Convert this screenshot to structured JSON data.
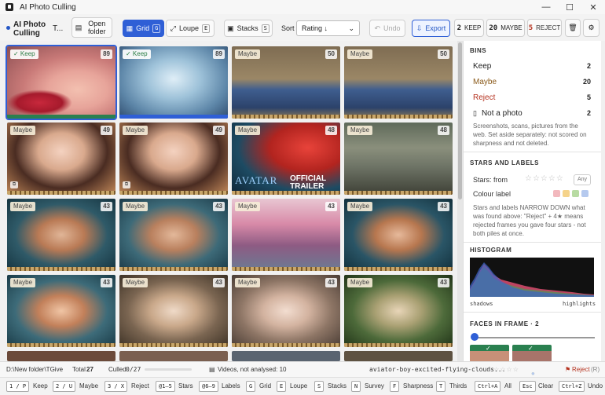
{
  "window": {
    "title": "AI Photo Culling"
  },
  "brand": {
    "name": "AI Photo Culling",
    "more": "T..."
  },
  "toolbar": {
    "open_folder": "Open folder",
    "grid": {
      "label": "Grid",
      "key": "G"
    },
    "loupe": {
      "label": "Loupe",
      "key": "E"
    },
    "stacks": {
      "label": "Stacks",
      "key": "S"
    },
    "sort_label": "Sort",
    "sort_value": "Rating ↓",
    "undo": "Undo",
    "export": "Export",
    "keep": {
      "count": "2",
      "label": "KEEP"
    },
    "maybe": {
      "count": "20",
      "label": "MAYBE"
    },
    "reject": {
      "count": "5",
      "label": "REJECT"
    }
  },
  "thumbs": [
    {
      "tag": "✓ Keep",
      "score": "89",
      "kind": "keep"
    },
    {
      "tag": "✓ Keep",
      "score": "89",
      "kind": "keep"
    },
    {
      "tag": "Maybe",
      "score": "50",
      "kind": "maybe"
    },
    {
      "tag": "Maybe",
      "score": "50",
      "kind": "maybe"
    },
    {
      "tag": "Maybe",
      "score": "49",
      "kind": "maybe"
    },
    {
      "tag": "Maybe",
      "score": "49",
      "kind": "maybe"
    },
    {
      "tag": "Maybe",
      "score": "48",
      "kind": "maybe",
      "trailer": "OFFICIAL TRAILER",
      "avatar": "AVATAR"
    },
    {
      "tag": "Maybe",
      "score": "48",
      "kind": "maybe"
    },
    {
      "tag": "Maybe",
      "score": "43",
      "kind": "maybe"
    },
    {
      "tag": "Maybe",
      "score": "43",
      "kind": "maybe"
    },
    {
      "tag": "Maybe",
      "score": "43",
      "kind": "maybe"
    },
    {
      "tag": "Maybe",
      "score": "43",
      "kind": "maybe"
    },
    {
      "tag": "Maybe",
      "score": "43",
      "kind": "maybe"
    },
    {
      "tag": "Maybe",
      "score": "43",
      "kind": "maybe"
    },
    {
      "tag": "Maybe",
      "score": "43",
      "kind": "maybe"
    },
    {
      "tag": "Maybe",
      "score": "43",
      "kind": "maybe"
    }
  ],
  "sidebar": {
    "bins_heading": "BINS",
    "bins": [
      {
        "label": "Keep",
        "count": "2",
        "color": "#222"
      },
      {
        "label": "Maybe",
        "count": "20",
        "color": "#8a5a1a"
      },
      {
        "label": "Reject",
        "count": "5",
        "color": "#b5321f"
      },
      {
        "label": "Not a photo",
        "count": "2",
        "color": "#222"
      }
    ],
    "bins_note": "Screenshots, scans, pictures from the web. Set aside separately: not scored on sharpness and not deleted.",
    "stars_heading": "STARS AND LABELS",
    "stars_label": "Stars: from",
    "stars": "☆☆☆☆☆",
    "any": "Any",
    "colour_label": "Colour label",
    "labels_note": "Stars and labels NARROW DOWN what was found above: \"Reject\" + 4★ means rejected frames you gave four stars - not both piles at once.",
    "histogram_heading": "HISTOGRAM",
    "shadows": "shadows",
    "highlights": "highlights",
    "faces_heading": "FACES IN FRAME · 2"
  },
  "status": {
    "path": "D:\\New folder\\TGive",
    "total_label": "Total",
    "total": "27",
    "culled_label": "Culled",
    "culled": "0/27",
    "videos": "Videos, not analysed: 10",
    "filename": "aviator-boy-excited-flying-clouds...",
    "reject_label": "Reject",
    "reject_key": "(R)"
  },
  "shortcuts": [
    {
      "key": "1 / P",
      "label": "Keep"
    },
    {
      "key": "2 / U",
      "label": "Maybe"
    },
    {
      "key": "3 / X",
      "label": "Reject"
    },
    {
      "key": "@1–5",
      "label": "Stars"
    },
    {
      "key": "@6–9",
      "label": "Labels"
    },
    {
      "key": "G",
      "label": "Grid"
    },
    {
      "key": "E",
      "label": "Loupe"
    },
    {
      "key": "S",
      "label": "Stacks"
    },
    {
      "key": "N",
      "label": "Survey"
    },
    {
      "key": "F",
      "label": "Sharpness"
    },
    {
      "key": "T",
      "label": "Thirds"
    },
    {
      "key": "Ctrl+A",
      "label": "All"
    },
    {
      "key": "Esc",
      "label": "Clear"
    },
    {
      "key": "Ctrl+Z",
      "label": "Undo"
    }
  ]
}
